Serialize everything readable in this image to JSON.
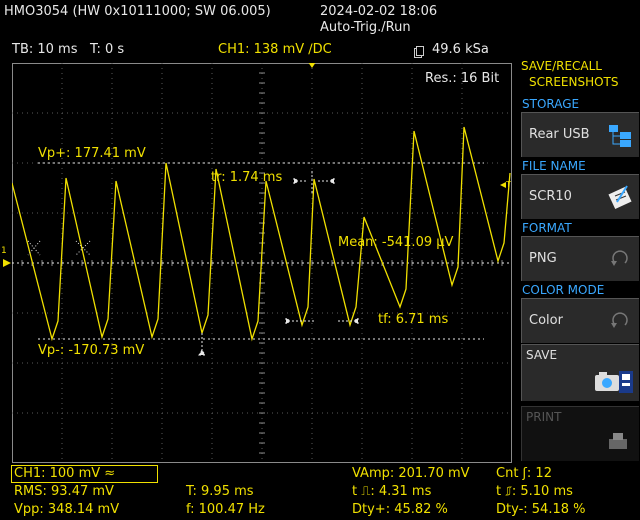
{
  "header": {
    "device": "HMO3054 (HW 0x10111000; SW 06.005)",
    "datetime": "2024-02-02 18:06",
    "mode": "Auto-Trig./Run",
    "timebase": "TB: 10 ms",
    "trigger_time": "T: 0 s",
    "ch1_trigger": "CH1: 138 mV ∕DC",
    "sample_rate": "49.6 kSa"
  },
  "screen": {
    "resolution": "Res.:  16 Bit",
    "vp_plus": "Vp+: 177.41 mV",
    "vp_minus": "Vp-: -170.73 mV",
    "rise_time": "tr: 1.74 ms",
    "fall_time": "tf: 6.71 ms",
    "mean": "Mean: -541.09 µV",
    "ch1_marker": "1",
    "trig_marker": "T"
  },
  "sidebar": {
    "title_line1": "SAVE/RECALL",
    "title_line2": "SCREENSHOTS",
    "storage_label": "STORAGE",
    "storage_value": "Rear USB",
    "file_name_label": "FILE NAME",
    "file_name_value": "SCR10",
    "format_label": "FORMAT",
    "format_value": "PNG",
    "color_mode_label": "COLOR MODE",
    "color_mode_value": "Color",
    "save_label": "SAVE",
    "print_label": "PRINT"
  },
  "measurements": {
    "channel": "CH1: 100 mV ≈",
    "rms": "RMS: 93.47 mV",
    "vpp": "Vpp: 348.14 mV",
    "period": "T: 9.95 ms",
    "frequency": "f: 100.47 Hz",
    "vamp": "VAmp: 201.70 mV",
    "t_pos_pulse": "t ⎍: 4.31 ms",
    "dty_pos": "Dty+: 45.82 %",
    "count": "Cnt ʃ: 12",
    "t_neg_pulse": "t ⎎: 5.10 ms",
    "dty_neg": "Dty-: 54.18 %"
  },
  "colors": {
    "trace": "#f0e000",
    "accent": "#3aa8ff",
    "grid": "#6a6a6a"
  }
}
